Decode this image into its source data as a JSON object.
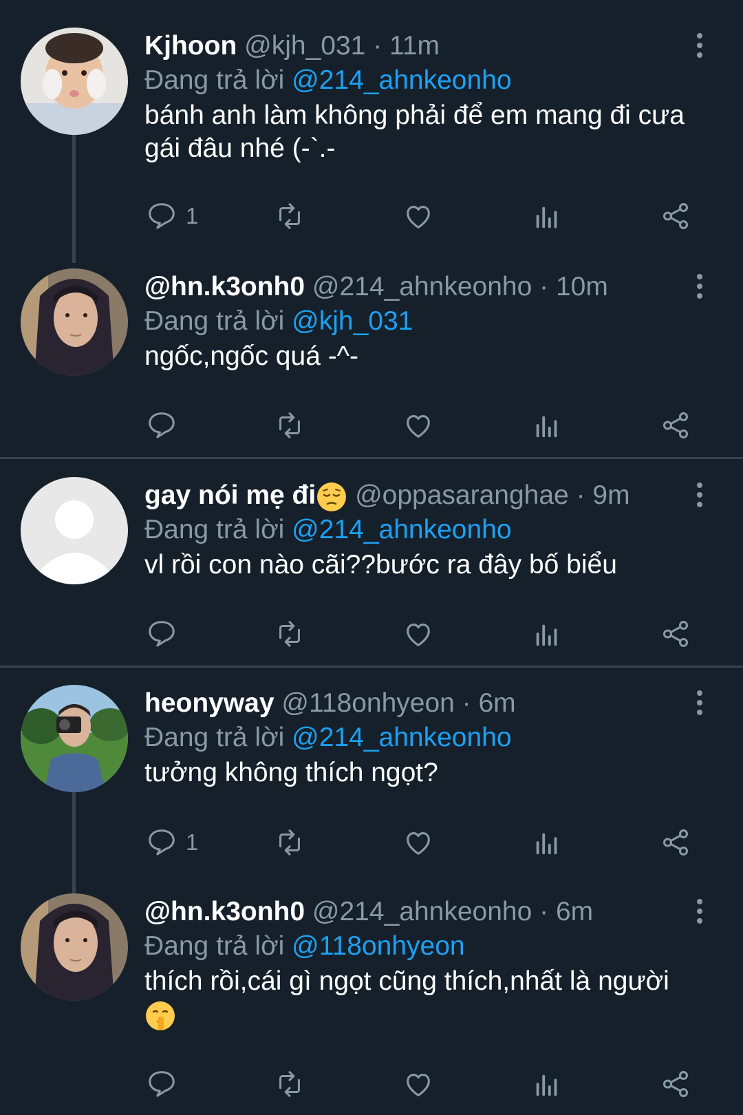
{
  "colors": {
    "background": "#15202b",
    "text": "#ffffff",
    "muted": "#8899a6",
    "accent": "#1da1f2",
    "divider": "#38444d"
  },
  "tweets": [
    {
      "display_name": "Kjhoon",
      "handle": "@kjh_031",
      "time": "· 11m",
      "replying_prefix": "Đang trả lời",
      "replying_to": "@214_ahnkeonho",
      "text": "bánh anh làm không phải để em mang đi cưa gái đâu nhé (-`.-",
      "reply_count": "1",
      "avatar": "kid-avatar"
    },
    {
      "display_name": "@hn.k3onh0",
      "handle": "@214_ahnkeonho",
      "time": "· 10m",
      "replying_prefix": "Đang trả lời",
      "replying_to": "@kjh_031",
      "text": "ngốc,ngốc quá -^-",
      "reply_count": "",
      "avatar": "hooded-avatar"
    },
    {
      "display_name": "gay nói mẹ đi",
      "display_name_emoji": "pensive-face-emoji",
      "handle": "@oppasaranghae",
      "time": "· 9m",
      "replying_prefix": "Đang trả lời",
      "replying_to": "@214_ahnkeonho",
      "text": "vl rồi con nào cãi??bước ra đây bố biểu",
      "reply_count": "",
      "avatar": "default-avatar"
    },
    {
      "display_name": "heonyway",
      "handle": "@118onhyeon",
      "time": "· 6m",
      "replying_prefix": "Đang trả lời",
      "replying_to": "@214_ahnkeonho",
      "text": "tưởng không thích ngọt?",
      "reply_count": "1",
      "avatar": "camera-avatar"
    },
    {
      "display_name": "@hn.k3onh0",
      "handle": "@214_ahnkeonho",
      "time": "· 6m",
      "replying_prefix": "Đang trả lời",
      "replying_to": "@118onhyeon",
      "text": "thích rồi,cái gì ngọt cũng thích,nhất là người",
      "text_emoji": "shushing-face-emoji",
      "reply_count": "",
      "avatar": "hooded-avatar"
    }
  ],
  "icons": [
    "reply-icon",
    "retweet-icon",
    "like-icon",
    "analytics-icon",
    "share-icon",
    "more-icon"
  ]
}
